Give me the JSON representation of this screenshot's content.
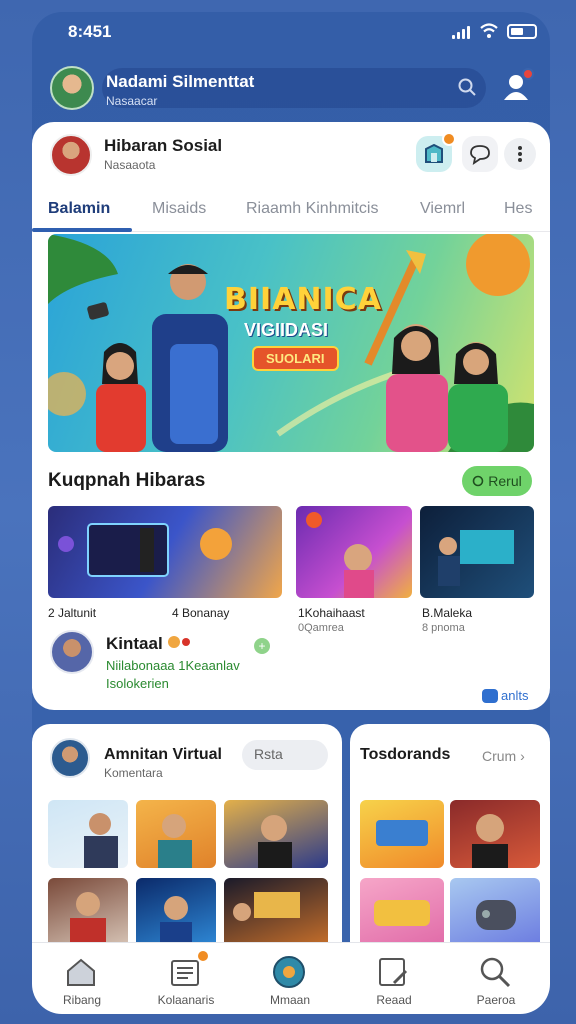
{
  "status": {
    "time": "8:451"
  },
  "account": {
    "name": "Nadami Silmenttat",
    "subtitle": "Nasaacar"
  },
  "card": {
    "header": {
      "name": "Hibaran Sosial",
      "subtitle": "Nasaaota"
    },
    "tabs": [
      {
        "label": "Balamin",
        "active": true
      },
      {
        "label": "Misaids"
      },
      {
        "label": "Riaamh Kinhmitcis"
      },
      {
        "label": "Viemrl"
      },
      {
        "label": "Hes"
      }
    ],
    "banner": {
      "title": "BIIANICA",
      "subtitle": "VIGIIDASI",
      "tag": "SUOLARI"
    },
    "section": {
      "title": "Kuqpnah Hibaras",
      "button": "Rerul"
    },
    "thumbs": [
      {
        "title": "2 Jaltunit",
        "meta": "4 Bonanay"
      },
      {
        "title": "1Kohaihaast",
        "meta": "0Qamrea"
      },
      {
        "title": "B.Maleka",
        "meta": "8 pnoma"
      }
    ],
    "creator": {
      "name": "Kintaal",
      "line1": "Niilabonaaa 1Keaanlav",
      "line2": "Isolokerien"
    },
    "more_link": "anlts"
  },
  "panel_left": {
    "title": "Amnitan Virtual",
    "subtitle": "Komentara",
    "button": "Rsta"
  },
  "panel_right": {
    "title": "Tosdorands",
    "more": "Crum"
  },
  "bottom_nav": [
    {
      "label": "Ribang",
      "icon": "home-icon"
    },
    {
      "label": "Kolaanaris",
      "icon": "list-icon"
    },
    {
      "label": "Mmaan",
      "icon": "globe-icon"
    },
    {
      "label": "Reaad",
      "icon": "edit-icon"
    },
    {
      "label": "Paeroa",
      "icon": "search-icon"
    }
  ],
  "colors": {
    "primary": "#2f5fb0",
    "accent_green": "#6fd36a",
    "badge": "#f08c22",
    "notif": "#e8453c"
  }
}
